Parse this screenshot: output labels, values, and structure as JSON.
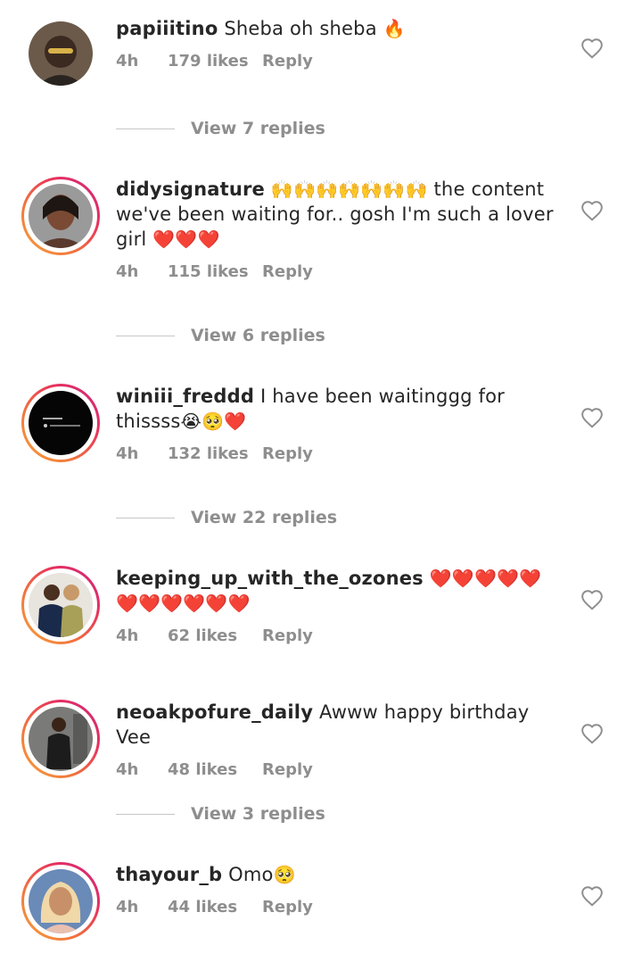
{
  "comments": [
    {
      "username": "papiiitino",
      "text": "Sheba oh sheba",
      "emoji": "🔥",
      "time": "4h",
      "likes": "179 likes",
      "reply_label": "Reply",
      "view_replies": "View 7 replies",
      "has_story_ring": false
    },
    {
      "username": "didysignature",
      "emoji_lead": "🙌🙌🙌🙌🙌🙌🙌",
      "text": "the content we've been waiting for.. gosh I'm such a lover girl",
      "emoji": "❤️❤️❤️",
      "time": "4h",
      "likes": "115 likes",
      "reply_label": "Reply",
      "view_replies": "View 6 replies",
      "has_story_ring": true
    },
    {
      "username": "winiii_freddd",
      "text": "I have been waitinggg for thissss",
      "emoji": "😭🥺❤️",
      "time": "4h",
      "likes": "132 likes",
      "reply_label": "Reply",
      "view_replies": "View 22 replies",
      "has_story_ring": true
    },
    {
      "username": "keeping_up_with_the_ozones",
      "text": "",
      "emoji": "❤️❤️❤️❤️❤️❤️❤️❤️❤️❤️❤️",
      "time": "4h",
      "likes": "62 likes",
      "reply_label": "Reply",
      "has_story_ring": true
    },
    {
      "username": "neoakpofure_daily",
      "text": "Awww happy birthday Vee",
      "emoji": "",
      "time": "4h",
      "likes": "48 likes",
      "reply_label": "Reply",
      "view_replies": "View 3 replies",
      "has_story_ring": true
    },
    {
      "username": "thayour_b",
      "text": "Omo",
      "emoji": "🥺",
      "time": "4h",
      "likes": "44 likes",
      "reply_label": "Reply",
      "has_story_ring": true
    }
  ],
  "icons": {
    "like": "heart-outline-icon"
  },
  "colors": {
    "meta_text": "#8e8e8e",
    "primary_text": "#262626",
    "ring_start": "#f9a23a",
    "ring_end": "#c9287f"
  }
}
